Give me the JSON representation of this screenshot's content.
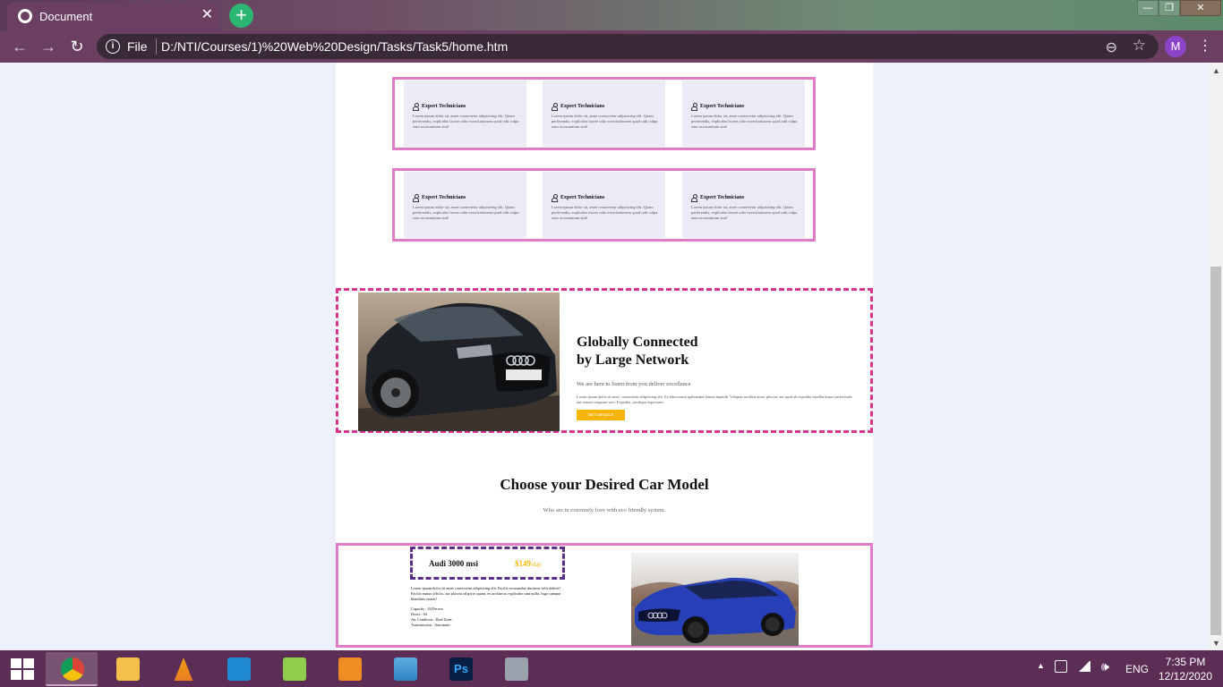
{
  "browser": {
    "tab_title": "Document",
    "tab_close": "✕",
    "new_tab": "+",
    "omnibox_label": "File",
    "url": "D:/NTI/Courses/1)%20Web%20Design/Tasks/Task5/home.htm",
    "profile_initial": "M",
    "window_controls": {
      "minimize": "—",
      "restore": "❐",
      "close": "✕"
    }
  },
  "cards_row1": [
    {
      "title": "Expert Technicians",
      "text": "Lorem ipsum dolor sit, amet consectetur adipisicing elit. Quam perferendis, explicabo facere odio exercitationem quod odit culpa eum accusantium sint!"
    },
    {
      "title": "Expert Technicians",
      "text": "Lorem ipsum dolor sit, amet consectetur adipisicing elit. Quam perferendis, explicabo facere odio exercitationem quod odit culpa eum accusantium sint!"
    },
    {
      "title": "Expert Technicians",
      "text": "Lorem ipsum dolor sit, amet consectetur adipisicing elit. Quam perferendis, explicabo facere odio exercitationem quod odit culpa eum accusantium sint!"
    }
  ],
  "cards_row2": [
    {
      "title": "Expert Technicians",
      "text": "Lorem ipsum dolor sit, amet consectetur adipisicing elit. Quam perferendis, explicabo facere odio exercitationem quod odit culpa eum accusantium sint!"
    },
    {
      "title": "Expert Technicians",
      "text": "Lorem ipsum dolor sit, amet consectetur adipisicing elit. Quam perferendis, explicabo facere odio exercitationem quod odit culpa eum accusantium sint!"
    },
    {
      "title": "Expert Technicians",
      "text": "Lorem ipsum dolor sit, amet consectetur adipisicing elit. Quam perferendis, explicabo facere odio exercitationem quod odit culpa eum accusantium sint!"
    }
  ],
  "feature": {
    "title_line1": "Globally Connected",
    "title_line2": "by Large Network",
    "subtitle": "We are here to listen from you deliver excellence",
    "paragraph": "Lorem ipsum dolor sit amet, consectetur adipisicing elit. Ea laboriosam quibusdam harum impedit. Voluptas mollitia amet, placeat, aut quod ab expedita repellat neque perferendis aut ratione magnam vero. Expedita, similique asperiores.",
    "button": "GET DETAILS"
  },
  "choose": {
    "title": "Choose your Desired Car Model",
    "subtitle": "Who are in extremely love with eco friendly system."
  },
  "model": {
    "name": "Audi 3000 msi",
    "price": "$149",
    "unit": "/day",
    "description": "Lorem ipsum dolor sit amet consectetur adipisicing elit. Facilis recusandae ducimus velit debitis? Facilis minus officiis, aut placeat ad porro quam, ex architecto explicabo sunt nulla, fuga cumque blanditiis omnis!",
    "specs": [
      "Capacity : 04 Person",
      "Doors : 04",
      "Air Condition : Dual Zone",
      "Transmission : Automatic"
    ]
  },
  "taskbar": {
    "apps": [
      "Google Chrome",
      "File Explorer",
      "VLC media player",
      "Visual Studio Code",
      "Notepad++",
      "Video player",
      "Photos",
      "Adobe Photoshop",
      "Calculator"
    ],
    "language": "ENG",
    "time": "7:35 PM",
    "date": "12/12/2020"
  },
  "colors": {
    "accent_pink": "#e27bc6",
    "dashed_magenta": "#d9338d",
    "dashed_purple": "#5a2e86",
    "price_gold": "#f6b400",
    "card_bg": "#eceaf6"
  }
}
